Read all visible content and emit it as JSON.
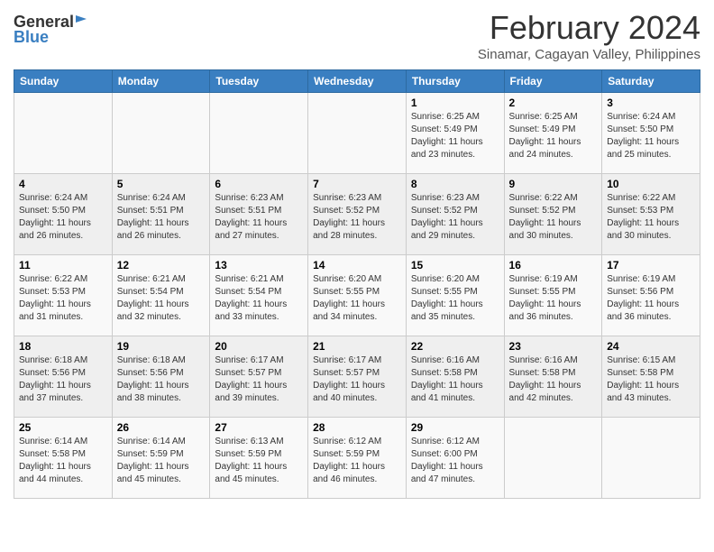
{
  "header": {
    "logo_general": "General",
    "logo_blue": "Blue",
    "month_title": "February 2024",
    "location": "Sinamar, Cagayan Valley, Philippines"
  },
  "weekdays": [
    "Sunday",
    "Monday",
    "Tuesday",
    "Wednesday",
    "Thursday",
    "Friday",
    "Saturday"
  ],
  "weeks": [
    [
      {
        "day": "",
        "sunrise": "",
        "sunset": "",
        "daylight": ""
      },
      {
        "day": "",
        "sunrise": "",
        "sunset": "",
        "daylight": ""
      },
      {
        "day": "",
        "sunrise": "",
        "sunset": "",
        "daylight": ""
      },
      {
        "day": "",
        "sunrise": "",
        "sunset": "",
        "daylight": ""
      },
      {
        "day": "1",
        "sunrise": "Sunrise: 6:25 AM",
        "sunset": "Sunset: 5:49 PM",
        "daylight": "Daylight: 11 hours and 23 minutes."
      },
      {
        "day": "2",
        "sunrise": "Sunrise: 6:25 AM",
        "sunset": "Sunset: 5:49 PM",
        "daylight": "Daylight: 11 hours and 24 minutes."
      },
      {
        "day": "3",
        "sunrise": "Sunrise: 6:24 AM",
        "sunset": "Sunset: 5:50 PM",
        "daylight": "Daylight: 11 hours and 25 minutes."
      }
    ],
    [
      {
        "day": "4",
        "sunrise": "Sunrise: 6:24 AM",
        "sunset": "Sunset: 5:50 PM",
        "daylight": "Daylight: 11 hours and 26 minutes."
      },
      {
        "day": "5",
        "sunrise": "Sunrise: 6:24 AM",
        "sunset": "Sunset: 5:51 PM",
        "daylight": "Daylight: 11 hours and 26 minutes."
      },
      {
        "day": "6",
        "sunrise": "Sunrise: 6:23 AM",
        "sunset": "Sunset: 5:51 PM",
        "daylight": "Daylight: 11 hours and 27 minutes."
      },
      {
        "day": "7",
        "sunrise": "Sunrise: 6:23 AM",
        "sunset": "Sunset: 5:52 PM",
        "daylight": "Daylight: 11 hours and 28 minutes."
      },
      {
        "day": "8",
        "sunrise": "Sunrise: 6:23 AM",
        "sunset": "Sunset: 5:52 PM",
        "daylight": "Daylight: 11 hours and 29 minutes."
      },
      {
        "day": "9",
        "sunrise": "Sunrise: 6:22 AM",
        "sunset": "Sunset: 5:52 PM",
        "daylight": "Daylight: 11 hours and 30 minutes."
      },
      {
        "day": "10",
        "sunrise": "Sunrise: 6:22 AM",
        "sunset": "Sunset: 5:53 PM",
        "daylight": "Daylight: 11 hours and 30 minutes."
      }
    ],
    [
      {
        "day": "11",
        "sunrise": "Sunrise: 6:22 AM",
        "sunset": "Sunset: 5:53 PM",
        "daylight": "Daylight: 11 hours and 31 minutes."
      },
      {
        "day": "12",
        "sunrise": "Sunrise: 6:21 AM",
        "sunset": "Sunset: 5:54 PM",
        "daylight": "Daylight: 11 hours and 32 minutes."
      },
      {
        "day": "13",
        "sunrise": "Sunrise: 6:21 AM",
        "sunset": "Sunset: 5:54 PM",
        "daylight": "Daylight: 11 hours and 33 minutes."
      },
      {
        "day": "14",
        "sunrise": "Sunrise: 6:20 AM",
        "sunset": "Sunset: 5:55 PM",
        "daylight": "Daylight: 11 hours and 34 minutes."
      },
      {
        "day": "15",
        "sunrise": "Sunrise: 6:20 AM",
        "sunset": "Sunset: 5:55 PM",
        "daylight": "Daylight: 11 hours and 35 minutes."
      },
      {
        "day": "16",
        "sunrise": "Sunrise: 6:19 AM",
        "sunset": "Sunset: 5:55 PM",
        "daylight": "Daylight: 11 hours and 36 minutes."
      },
      {
        "day": "17",
        "sunrise": "Sunrise: 6:19 AM",
        "sunset": "Sunset: 5:56 PM",
        "daylight": "Daylight: 11 hours and 36 minutes."
      }
    ],
    [
      {
        "day": "18",
        "sunrise": "Sunrise: 6:18 AM",
        "sunset": "Sunset: 5:56 PM",
        "daylight": "Daylight: 11 hours and 37 minutes."
      },
      {
        "day": "19",
        "sunrise": "Sunrise: 6:18 AM",
        "sunset": "Sunset: 5:56 PM",
        "daylight": "Daylight: 11 hours and 38 minutes."
      },
      {
        "day": "20",
        "sunrise": "Sunrise: 6:17 AM",
        "sunset": "Sunset: 5:57 PM",
        "daylight": "Daylight: 11 hours and 39 minutes."
      },
      {
        "day": "21",
        "sunrise": "Sunrise: 6:17 AM",
        "sunset": "Sunset: 5:57 PM",
        "daylight": "Daylight: 11 hours and 40 minutes."
      },
      {
        "day": "22",
        "sunrise": "Sunrise: 6:16 AM",
        "sunset": "Sunset: 5:58 PM",
        "daylight": "Daylight: 11 hours and 41 minutes."
      },
      {
        "day": "23",
        "sunrise": "Sunrise: 6:16 AM",
        "sunset": "Sunset: 5:58 PM",
        "daylight": "Daylight: 11 hours and 42 minutes."
      },
      {
        "day": "24",
        "sunrise": "Sunrise: 6:15 AM",
        "sunset": "Sunset: 5:58 PM",
        "daylight": "Daylight: 11 hours and 43 minutes."
      }
    ],
    [
      {
        "day": "25",
        "sunrise": "Sunrise: 6:14 AM",
        "sunset": "Sunset: 5:58 PM",
        "daylight": "Daylight: 11 hours and 44 minutes."
      },
      {
        "day": "26",
        "sunrise": "Sunrise: 6:14 AM",
        "sunset": "Sunset: 5:59 PM",
        "daylight": "Daylight: 11 hours and 45 minutes."
      },
      {
        "day": "27",
        "sunrise": "Sunrise: 6:13 AM",
        "sunset": "Sunset: 5:59 PM",
        "daylight": "Daylight: 11 hours and 45 minutes."
      },
      {
        "day": "28",
        "sunrise": "Sunrise: 6:12 AM",
        "sunset": "Sunset: 5:59 PM",
        "daylight": "Daylight: 11 hours and 46 minutes."
      },
      {
        "day": "29",
        "sunrise": "Sunrise: 6:12 AM",
        "sunset": "Sunset: 6:00 PM",
        "daylight": "Daylight: 11 hours and 47 minutes."
      },
      {
        "day": "",
        "sunrise": "",
        "sunset": "",
        "daylight": ""
      },
      {
        "day": "",
        "sunrise": "",
        "sunset": "",
        "daylight": ""
      }
    ]
  ]
}
